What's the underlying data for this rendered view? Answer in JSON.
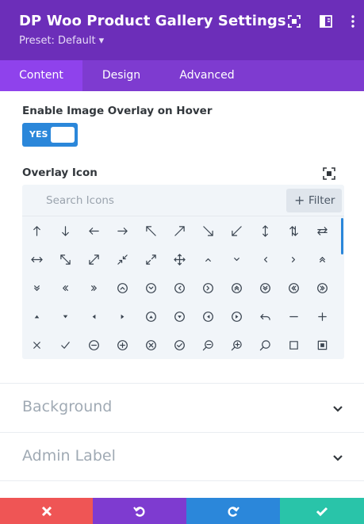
{
  "header": {
    "title": "DP Woo Product Gallery Settings",
    "preset": "Preset: Default ▾",
    "icons": [
      "expand-icon",
      "sidebar-toggle-icon",
      "more-vertical-icon"
    ]
  },
  "tabs": [
    {
      "label": "Content",
      "active": true
    },
    {
      "label": "Design",
      "active": false
    },
    {
      "label": "Advanced",
      "active": false
    }
  ],
  "overlay": {
    "label": "Enable Image Overlay on Hover",
    "toggle_value": "YES"
  },
  "overlay_icon": {
    "label": "Overlay Icon",
    "search_placeholder": "Search Icons",
    "filter_label": "Filter",
    "filter_plus": "+"
  },
  "icons_grid": [
    [
      "arrow-up-icon",
      "arrow-down-icon",
      "arrow-left-icon",
      "arrow-right-icon",
      "arrow-up-left-icon",
      "arrow-up-right-icon",
      "arrow-down-right-icon",
      "arrow-down-left-icon",
      "arrow-up-down-icon",
      "arrows-swap-vertical-icon",
      "arrows-swap-horizontal-icon"
    ],
    [
      "arrow-left-right-icon",
      "resize-diagonal-icon",
      "expand-diagonal-icon",
      "collapse-diagonal-icon",
      "expand-corner-icon",
      "move-icon",
      "chevron-up-icon",
      "chevron-down-icon",
      "chevron-left-icon",
      "chevron-right-icon",
      "double-chevron-up-icon"
    ],
    [
      "double-chevron-down-icon",
      "double-chevron-left-icon",
      "double-chevron-right-icon",
      "circle-chevron-up-icon",
      "circle-chevron-down-icon",
      "circle-chevron-left-icon",
      "circle-chevron-right-icon",
      "circle-double-up-icon",
      "circle-double-down-icon",
      "circle-double-left-icon",
      "circle-double-right-icon"
    ],
    [
      "caret-up-icon",
      "caret-down-icon",
      "caret-left-icon",
      "caret-right-icon",
      "circle-caret-up-icon",
      "circle-caret-down-icon",
      "circle-caret-left-icon",
      "circle-caret-right-icon",
      "undo-icon",
      "minus-icon",
      "plus-icon"
    ],
    [
      "close-icon",
      "check-icon",
      "circle-minus-icon",
      "circle-plus-icon",
      "circle-close-icon",
      "circle-check-icon",
      "zoom-out-icon",
      "zoom-in-icon",
      "search-icon",
      "square-icon",
      "square-dot-icon"
    ]
  ],
  "sections": [
    {
      "title": "Background"
    },
    {
      "title": "Admin Label"
    }
  ],
  "footer": {
    "buttons": [
      {
        "name": "discard-button",
        "icon": "close-icon",
        "color": "#ef5555"
      },
      {
        "name": "undo-button",
        "icon": "undo-icon",
        "color": "#7e3bd0"
      },
      {
        "name": "redo-button",
        "icon": "redo-icon",
        "color": "#2b87da"
      },
      {
        "name": "save-button",
        "icon": "check-icon",
        "color": "#29c4a9"
      }
    ]
  },
  "colors": {
    "header_bg": "#6c2eb9",
    "tabs_bg": "#7e3bd0",
    "active_tab_bg": "#8f42ec",
    "toggle_bg": "#2b87da"
  }
}
